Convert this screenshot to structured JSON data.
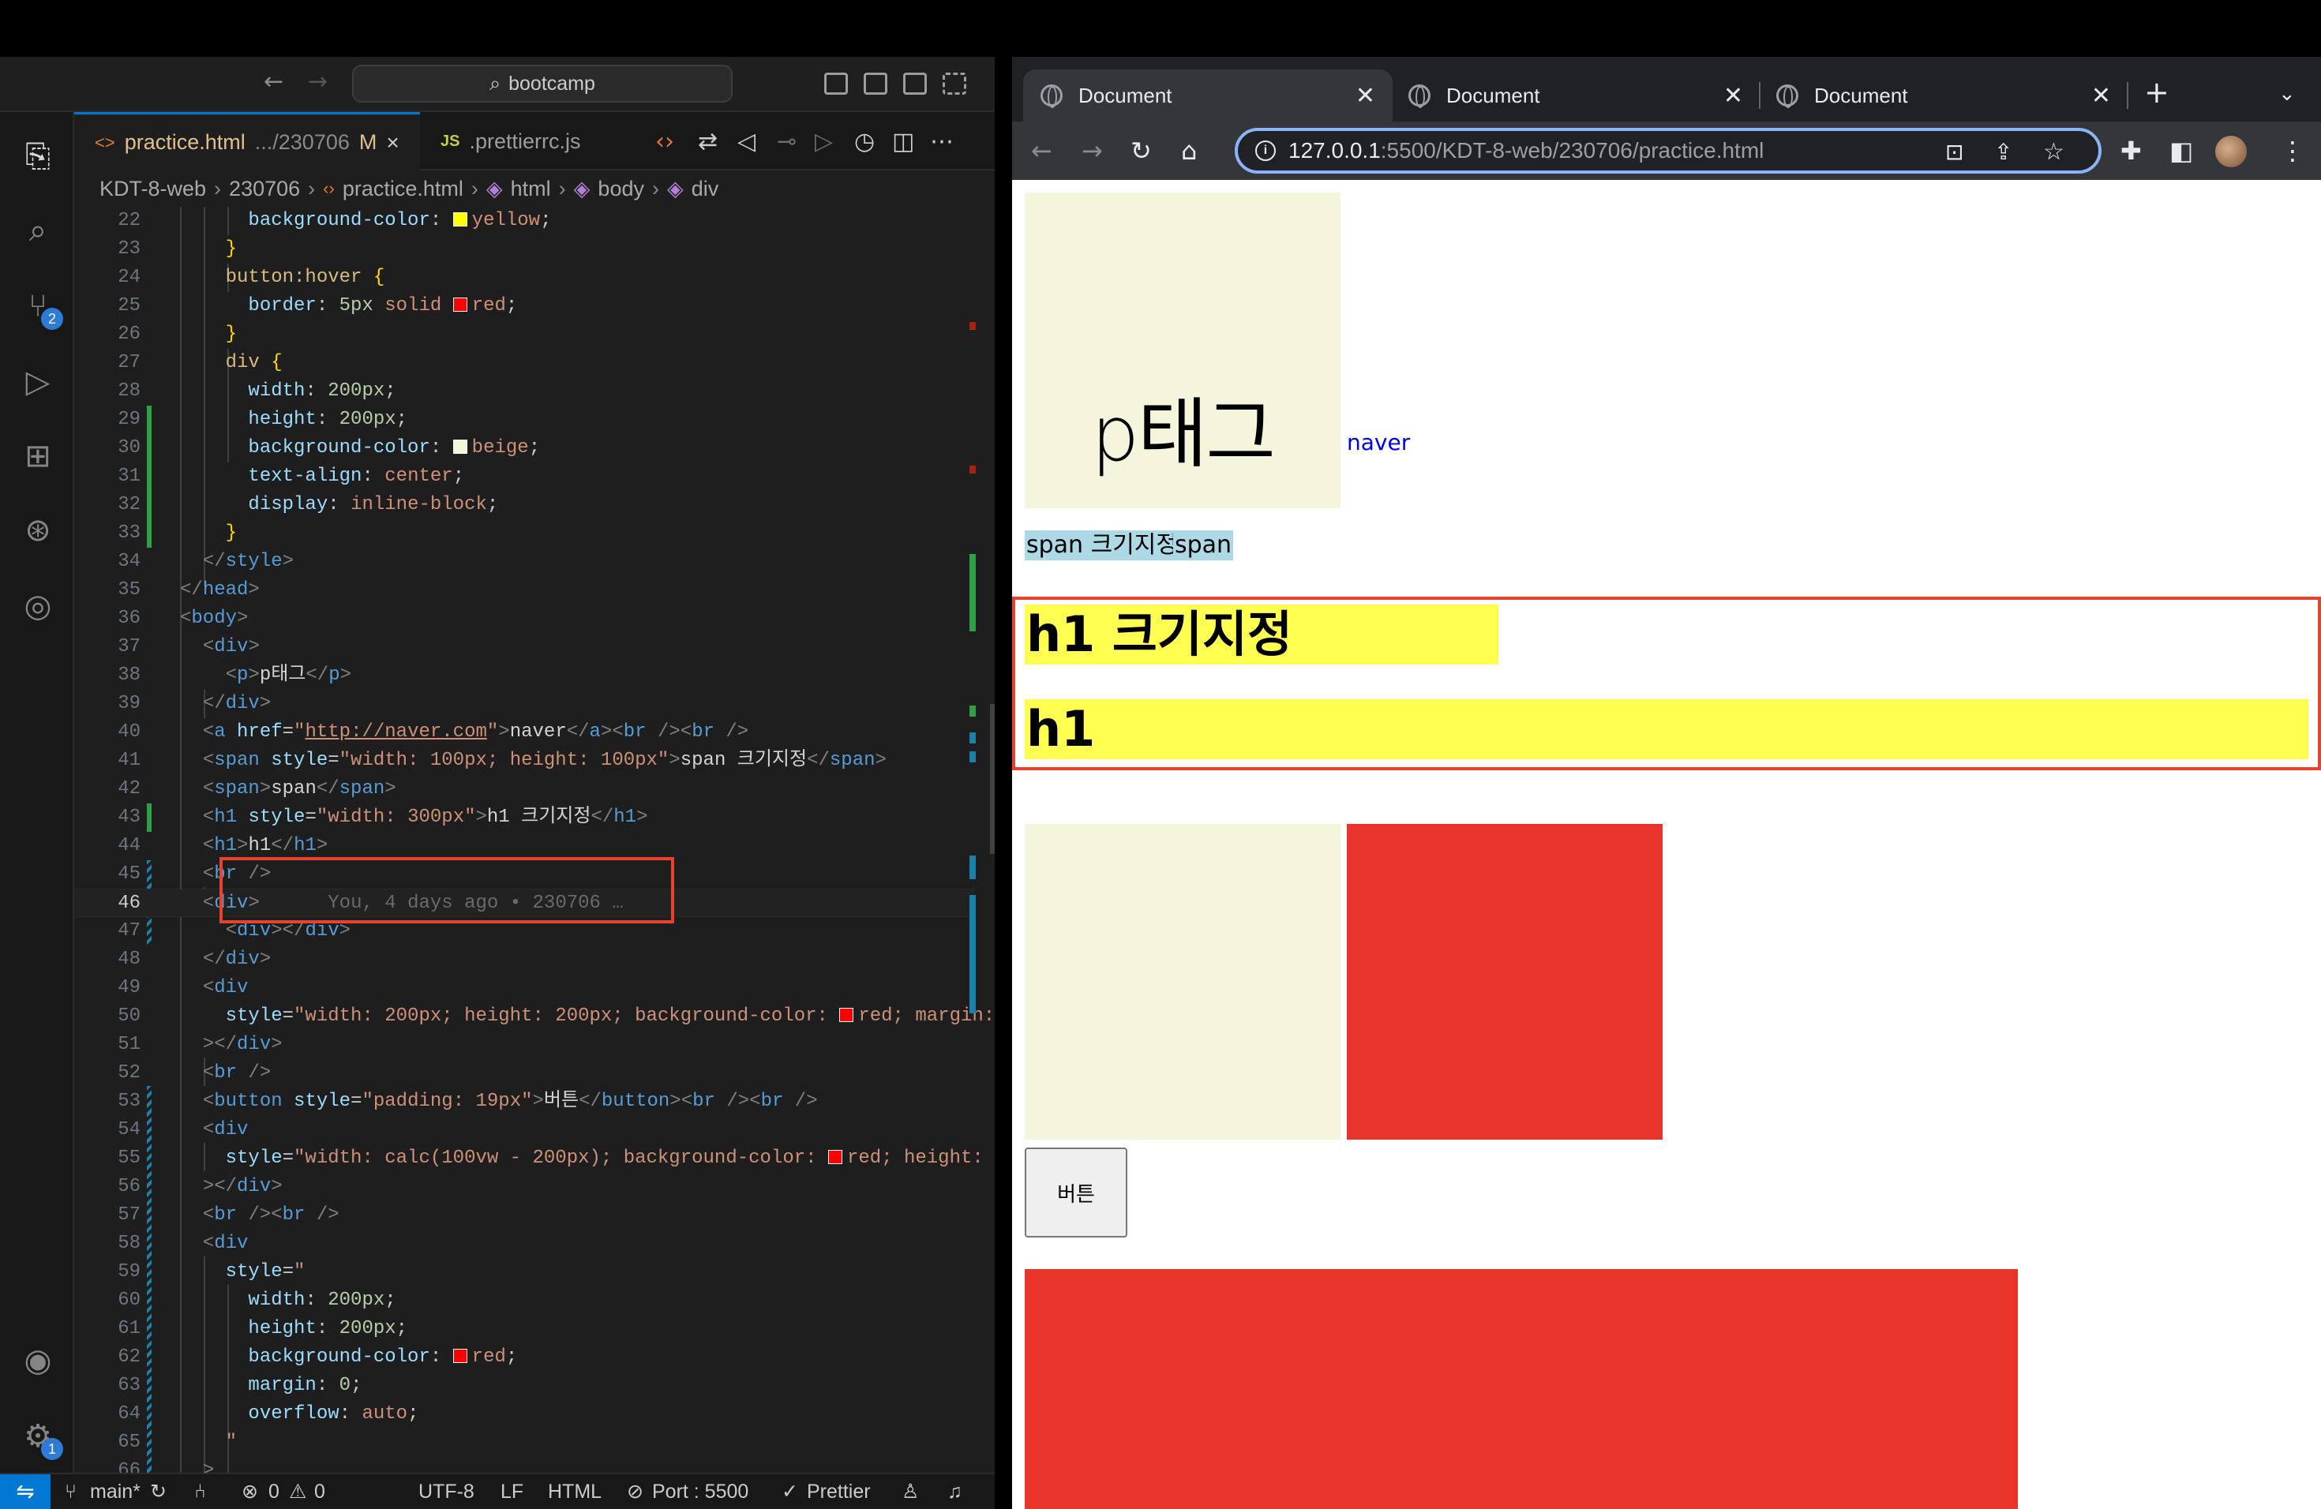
{
  "editor": {
    "command_center": "bootcamp",
    "tabs": [
      {
        "icon": "<>",
        "name": "practice.html",
        "path": ".../230706",
        "status": "M",
        "close": "×"
      },
      {
        "icon": "JS",
        "name": ".prettierrc.js"
      }
    ],
    "breadcrumb": [
      "KDT-8-web",
      "230706",
      "practice.html",
      "html",
      "body",
      "div"
    ],
    "activity_badges": {
      "source_control": "2",
      "settings": "1"
    },
    "blame": "You, 4 days ago • 230706 …",
    "current_line": 46
  },
  "status_bar": {
    "branch": "main*",
    "errors": "0",
    "warnings": "0",
    "encoding": "UTF-8",
    "eol": "LF",
    "language": "HTML",
    "port": "Port : 5500",
    "formatter": "Prettier"
  },
  "browser": {
    "tabs": [
      "Document",
      "Document",
      "Document"
    ],
    "url_host": "127.0.0.1",
    "url_rest": ":5500/KDT-8-web/230706/practice.html",
    "page": {
      "p_text": "p태그",
      "link": "naver",
      "span1": "span 크기지정",
      "span2": "span",
      "h1_a": "h1 크기지정",
      "h1_b": "h1",
      "button": "버튼"
    }
  },
  "colors": {
    "accent": "#0078d4",
    "highlight_box": "#e8412e",
    "beige": "#f5f5dc",
    "red": "#e8342a",
    "yellow": "#ffff52",
    "span_bg": "#add8e6"
  }
}
